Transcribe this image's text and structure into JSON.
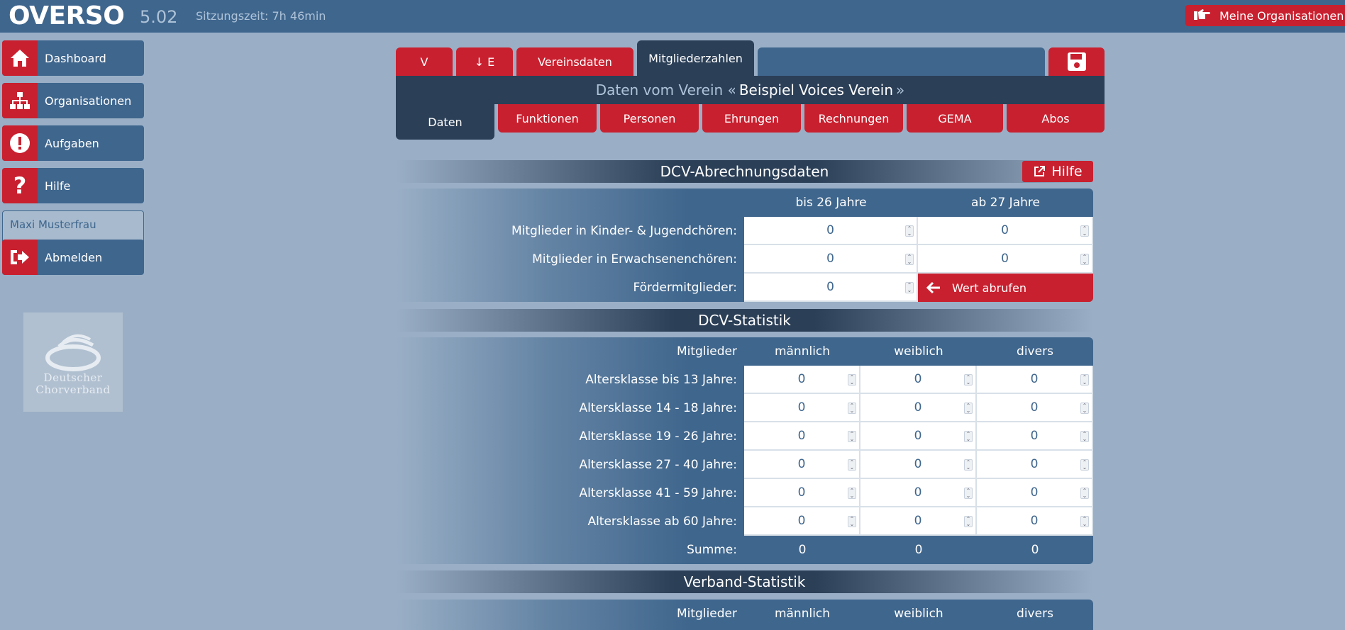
{
  "header": {
    "logo": "OVERSO",
    "version": "5.02",
    "session": "Sitzungszeit: 7h 46min",
    "org_button": "Meine Organisationen"
  },
  "sidebar": {
    "items": [
      {
        "label": "Dashboard",
        "icon": "home-icon"
      },
      {
        "label": "Organisationen",
        "icon": "sitemap-icon"
      },
      {
        "label": "Aufgaben",
        "icon": "exclamation-icon"
      },
      {
        "label": "Hilfe",
        "icon": "question-icon"
      }
    ],
    "user": "Maxi Musterfrau",
    "logout": "Abmelden",
    "brand_logo_text": [
      "Deutscher",
      "Chorverband"
    ]
  },
  "tabs": {
    "t1": "V",
    "t2": "↓ E",
    "t3": "Vereinsdaten",
    "t4": "Mitgliederzahlen"
  },
  "band": {
    "prefix": "Daten vom Verein «",
    "name": "Beispiel Voices Verein",
    "suffix": "»"
  },
  "subtabs": [
    "Daten",
    "Funktionen",
    "Personen",
    "Ehrungen",
    "Rechnungen",
    "GEMA",
    "Abos"
  ],
  "abrechnung": {
    "title": "DCV-Abrechnungsdaten",
    "help": "Hilfe",
    "col1": "bis 26 Jahre",
    "col2": "ab 27 Jahre",
    "rows": [
      {
        "label": "Mitglieder in Kinder- & Jugendchören:",
        "v1": "0",
        "v2": "0"
      },
      {
        "label": "Mitglieder in Erwachsenenchören:",
        "v1": "0",
        "v2": "0"
      },
      {
        "label": "Fördermitglieder:",
        "v1": "0"
      }
    ],
    "fetch": "Wert abrufen"
  },
  "statistik": {
    "title": "DCV-Statistik",
    "head": "Mitglieder",
    "cols": [
      "männlich",
      "weiblich",
      "divers"
    ],
    "rows": [
      {
        "label": "Altersklasse bis 13 Jahre:",
        "m": "0",
        "w": "0",
        "d": "0"
      },
      {
        "label": "Altersklasse 14 - 18 Jahre:",
        "m": "0",
        "w": "0",
        "d": "0"
      },
      {
        "label": "Altersklasse 19 - 26 Jahre:",
        "m": "0",
        "w": "0",
        "d": "0"
      },
      {
        "label": "Altersklasse 27 - 40 Jahre:",
        "m": "0",
        "w": "0",
        "d": "0"
      },
      {
        "label": "Altersklasse 41 - 59 Jahre:",
        "m": "0",
        "w": "0",
        "d": "0"
      },
      {
        "label": "Altersklasse ab 60 Jahre:",
        "m": "0",
        "w": "0",
        "d": "0"
      }
    ],
    "sum_label": "Summe:",
    "sum": {
      "m": "0",
      "w": "0",
      "d": "0"
    }
  },
  "verband": {
    "title": "Verband-Statistik",
    "head": "Mitglieder",
    "cols": [
      "männlich",
      "weiblich",
      "divers"
    ]
  },
  "colors": {
    "accent": "#c9202f",
    "primary": "#3f668d",
    "dark": "#2b3f57",
    "background": "#9aafc6"
  }
}
